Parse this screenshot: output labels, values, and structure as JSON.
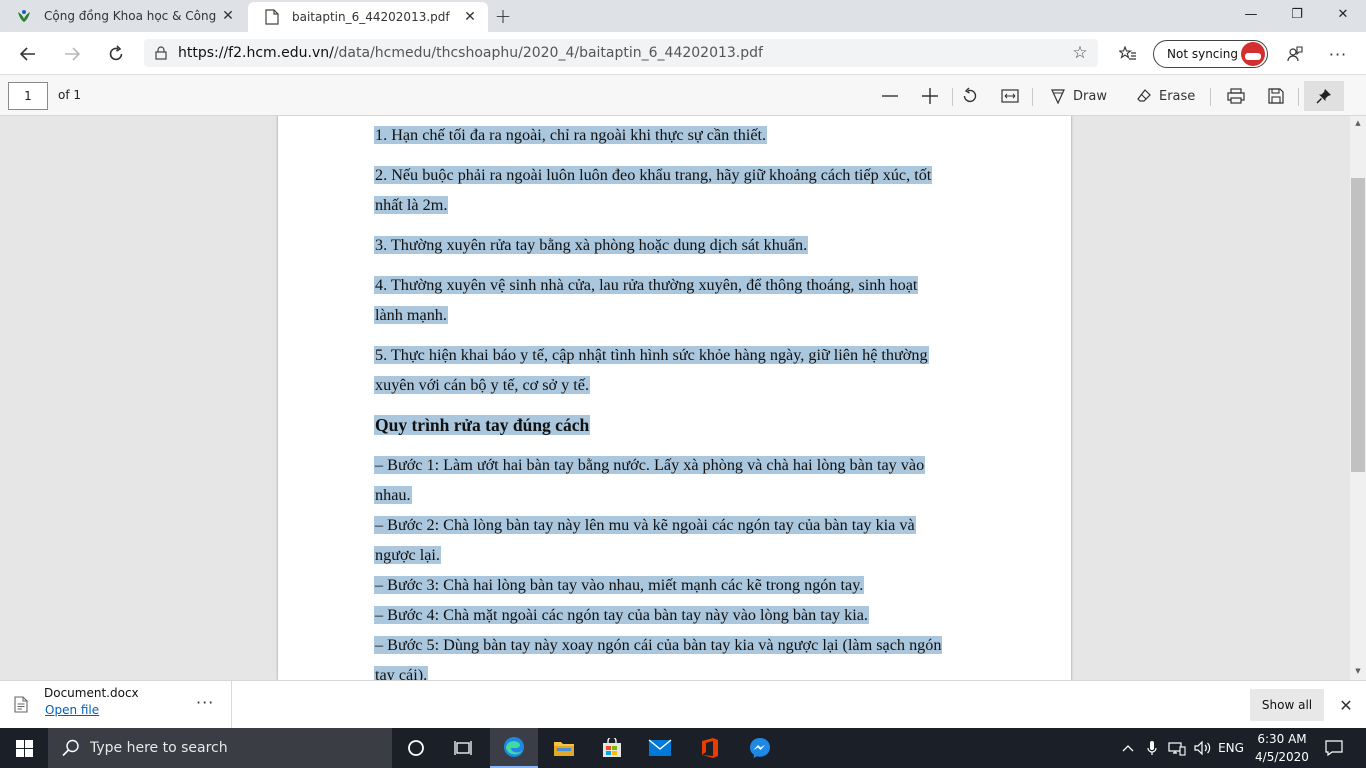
{
  "browser": {
    "tabs": [
      {
        "title": "Cộng đồng Khoa học & Công nghệ",
        "active": false
      },
      {
        "title": "baitaptin_6_44202013.pdf",
        "active": true
      }
    ],
    "url_host": "https://f2.hcm.edu.vn/",
    "url_path": "/data/hcmedu/thcshoaphu/2020_4/baitaptin_6_44202013.pdf",
    "profile_label": "Not syncing"
  },
  "pdf_toolbar": {
    "page_number": "1",
    "page_total": "of 1",
    "draw_label": "Draw",
    "erase_label": "Erase"
  },
  "document": {
    "items": [
      [
        "1. Hạn chế tối đa ra ngoài, chỉ ra ngoài khi thực sự cần thiết."
      ],
      [
        "2. Nếu buộc phải ra ngoài luôn luôn đeo khẩu trang, hãy giữ khoảng cách tiếp xúc, tốt",
        "nhất là 2m."
      ],
      [
        "3.  Thường xuyên rửa tay bằng xà phòng hoặc dung dịch sát khuẩn."
      ],
      [
        "4. Thường xuyên vệ sinh nhà cửa, lau rửa thường xuyên, để thông thoáng, sinh hoạt",
        "lành mạnh."
      ],
      [
        "5. Thực hiện khai báo y tế, cập nhật tình hình sức khỏe hàng ngày, giữ liên hệ thường",
        "xuyên với cán bộ y tế, cơ sở y tế."
      ]
    ],
    "heading": "Quy trình rửa tay đúng cách",
    "steps": [
      [
        "– Bước 1: Làm ướt hai bàn tay bằng nước. Lấy xà phòng và chà hai lòng bàn tay vào",
        "nhau."
      ],
      [
        "– Bước 2: Chà lòng bàn tay này lên mu và kẽ ngoài các ngón tay của bàn tay kia và",
        "ngược lại."
      ],
      [
        "– Bước 3: Chà hai  lòng bàn tay vào nhau, miết mạnh các kẽ trong ngón tay."
      ],
      [
        "– Bước 4: Chà mặt ngoài các ngón tay của bàn tay này vào lòng bàn tay kia."
      ],
      [
        "– Bước 5: Dùng bàn tay này xoay ngón cái của bàn tay kia và ngược lại (làm sạch ngón",
        "tay cái)."
      ]
    ]
  },
  "download": {
    "file_name": "Document.docx",
    "open_label": "Open file",
    "show_all_label": "Show all"
  },
  "taskbar": {
    "search_placeholder": "Type here to search",
    "language": "ENG",
    "time": "6:30 AM",
    "date": "4/5/2020"
  },
  "colors": {
    "selection_highlight": "#aac7de",
    "taskbar_bg": "#1b1f27",
    "tabstrip_bg": "#dee1e6"
  }
}
